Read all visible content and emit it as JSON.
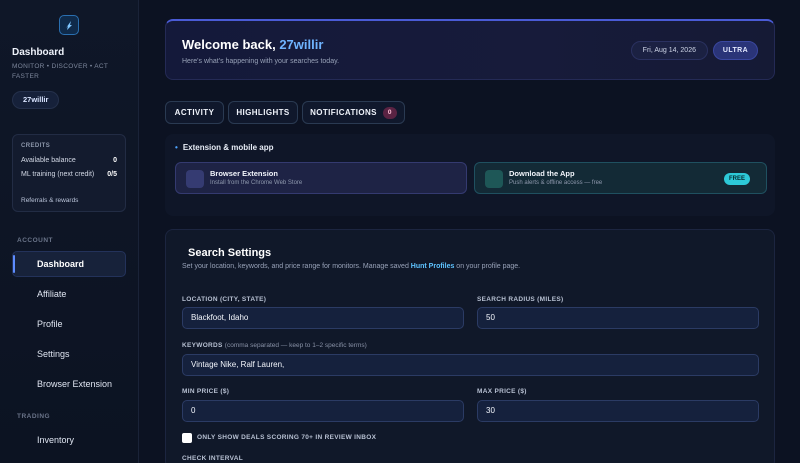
{
  "sidebar": {
    "title": "Dashboard",
    "tagline": "MONITOR • DISCOVER • ACT FASTER",
    "user": "27willir",
    "credits": {
      "header": "CREDITS",
      "available_label": "Available balance",
      "available_value": "0",
      "ml_label": "ML training (next credit)",
      "ml_value": "0/5",
      "link": "Referrals & rewards"
    },
    "account_label": "ACCOUNT",
    "account_items": [
      "Dashboard",
      "Affiliate",
      "Profile",
      "Settings",
      "Browser Extension"
    ],
    "trading_label": "TRADING",
    "trading_items": [
      "Inventory"
    ]
  },
  "welcome": {
    "greeting": "Welcome back, ",
    "username": "27willir",
    "subtitle": "Here's what's happening with your searches today.",
    "date": "Fri, Aug 14, 2026",
    "tier": "ULTRA"
  },
  "tabs": {
    "activity": "ACTIVITY",
    "highlights": "HIGHLIGHTS",
    "notifications": "NOTIFICATIONS",
    "notifications_count": "0"
  },
  "extension": {
    "title": "Extension & mobile app",
    "browser_title": "Browser Extension",
    "browser_desc": "Install from the Chrome Web Store",
    "app_title": "Download the App",
    "app_desc": "Push alerts & offline access — free",
    "app_badge": "FREE"
  },
  "settings": {
    "title": "Search Settings",
    "desc_before": "Set your location, keywords, and price range for monitors. Manage saved ",
    "desc_link": "Hunt Profiles",
    "desc_after": " on your profile page.",
    "location_label": "LOCATION (CITY, STATE)",
    "location_value": "Blackfoot, Idaho",
    "radius_label": "SEARCH RADIUS (MILES)",
    "radius_value": "50",
    "keywords_label": "KEYWORDS",
    "keywords_hint": "(comma separated — keep to 1–2 specific terms)",
    "keywords_value": "Vintage Nike, Ralf Lauren,",
    "min_label": "MIN PRICE ($)",
    "min_value": "0",
    "max_label": "MAX PRICE ($)",
    "max_value": "30",
    "checkbox_label": "ONLY SHOW DEALS SCORING 70+ IN REVIEW INBOX",
    "interval_label": "CHECK INTERVAL"
  },
  "colors": {
    "accent": "#5d8cff",
    "username": "#6fb4ff",
    "link": "#5ec3ff",
    "free_badge": "#2dc9d8"
  }
}
